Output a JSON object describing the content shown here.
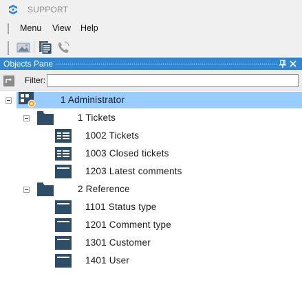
{
  "app": {
    "title": "SUPPORT",
    "icon": "app-logo-icon"
  },
  "menu": {
    "items": [
      "Menu",
      "View",
      "Help"
    ]
  },
  "toolbar": {
    "buttons": [
      {
        "name": "open-image-button",
        "icon": "picture-icon"
      },
      {
        "name": "documents-button",
        "icon": "documents-icon"
      },
      {
        "name": "phone-button",
        "icon": "phone-icon"
      }
    ]
  },
  "pane": {
    "title": "Objects Pane",
    "pin_icon": "pin-icon",
    "close_icon": "close-icon"
  },
  "filter": {
    "label": "Filter:",
    "value": "",
    "placeholder": ""
  },
  "colors": {
    "pane_header": "#2f86d1",
    "selection": "#99ccff",
    "node_icon": "#2e4d66"
  },
  "tree": {
    "root": {
      "label": "1 Administrator",
      "icon": "administrator-icon",
      "expanded": true,
      "selected": true
    },
    "groups": [
      {
        "label": "1 Tickets",
        "icon": "folder-icon",
        "expanded": true,
        "items": [
          {
            "label": "1002 Tickets",
            "icon": "list-view-icon"
          },
          {
            "label": "1003 Closed tickets",
            "icon": "list-view-icon"
          },
          {
            "label": "1203 Latest comments",
            "icon": "form-view-icon"
          }
        ]
      },
      {
        "label": "2 Reference",
        "icon": "folder-icon",
        "expanded": true,
        "items": [
          {
            "label": "1101 Status type",
            "icon": "form-view-icon"
          },
          {
            "label": "1201 Comment type",
            "icon": "form-view-icon"
          },
          {
            "label": "1301 Customer",
            "icon": "form-view-icon"
          },
          {
            "label": "1401 User",
            "icon": "form-view-icon"
          }
        ]
      }
    ]
  }
}
